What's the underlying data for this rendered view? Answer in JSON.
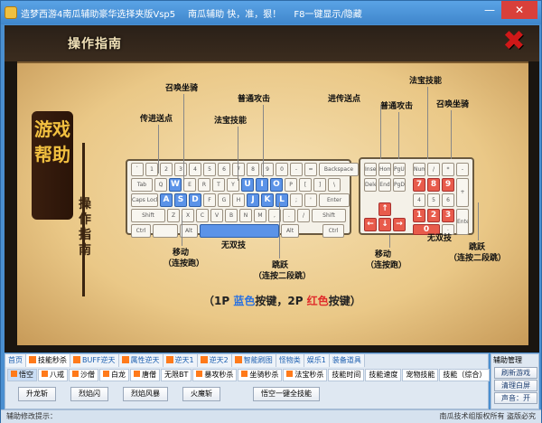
{
  "window": {
    "title_segments": [
      "造梦西游4南瓜辅助豪华选择夹版Vsp5",
      "南瓜辅助 快，准，狠！",
      "F8一键显示/隐藏"
    ],
    "minimize": "—",
    "close": "✕"
  },
  "game": {
    "guide_title": "操作指南",
    "close_symbol": "✖",
    "vertical_title": "游戏帮助",
    "vertical_subtitle": "操作指南",
    "callouts": {
      "summon": "召唤坐骑",
      "normal_attack": "普通攻击",
      "teleport": "传进送点",
      "magic_skill": "法宝技能",
      "move": "移动",
      "move_sub": "（连按跑）",
      "no_double": "无双技",
      "jump": "跳跃",
      "jump_sub": "（连按二段跳）",
      "teleport2": "进传送点",
      "normal_attack2": "普通攻击",
      "magic_skill2": "法宝技能",
      "summon2": "召唤坐骑",
      "move2": "移动",
      "move2_sub": "（连按跑）",
      "no_double2": "无双技",
      "jump2": "跳跃",
      "jump2_sub": "（连按二段跳）"
    },
    "legend": {
      "open": "（1P ",
      "blue_word": "蓝色",
      "mid": "按键，2P ",
      "red_word": "红色",
      "close": "按键）"
    },
    "keys_left": {
      "row1": [
        "`",
        "1",
        "2",
        "3",
        "4",
        "5",
        "6",
        "7",
        "8",
        "9",
        "0",
        "-",
        "=",
        "Backspace"
      ],
      "row2": [
        "Tab",
        "Q",
        "W",
        "E",
        "R",
        "T",
        "Y",
        "U",
        "I",
        "O",
        "P",
        "[",
        "]",
        "\\"
      ],
      "row3": [
        "Caps Lock",
        "A",
        "S",
        "D",
        "F",
        "G",
        "H",
        "J",
        "K",
        "L",
        ";",
        "'",
        "Enter"
      ],
      "row4": [
        "Shift",
        "Z",
        "X",
        "C",
        "V",
        "B",
        "N",
        "M",
        ",",
        ".",
        "/",
        "Shift"
      ],
      "row5": [
        "Ctrl",
        "Alt",
        "Alt",
        "Ctrl"
      ]
    },
    "keys_nav": {
      "top": [
        "Insert",
        "Home",
        "PgUp",
        "Delete",
        "End",
        "PgDn"
      ],
      "up": "↑",
      "left": "←",
      "down": "↓",
      "right": "→"
    },
    "keys_num": {
      "top": [
        "Num Lock",
        "/",
        "*",
        "-"
      ],
      "r1": [
        "7",
        "8",
        "9"
      ],
      "r2": [
        "4",
        "5",
        "6",
        "+"
      ],
      "r3": [
        "1",
        "2",
        "3"
      ],
      "r4": [
        "0",
        ".",
        "Enter"
      ]
    }
  },
  "panel": {
    "tabs": [
      {
        "label": "首页",
        "num": false
      },
      {
        "label": "技能秒杀",
        "num": true
      },
      {
        "label": "BUFF逆天",
        "num": true
      },
      {
        "label": "属性逆天",
        "num": true
      },
      {
        "label": "逆天1",
        "num": true
      },
      {
        "label": "逆天2",
        "num": true
      },
      {
        "label": "智能刷图",
        "num": true
      },
      {
        "label": "怪物类",
        "num": false
      },
      {
        "label": "娱乐1",
        "num": false
      },
      {
        "label": "装备道具",
        "num": false
      }
    ],
    "characters": [
      {
        "label": "悟空",
        "icon": true
      },
      {
        "label": "八戒",
        "icon": true
      },
      {
        "label": "沙僧",
        "icon": true
      },
      {
        "label": "白龙",
        "icon": true
      },
      {
        "label": "唐僧",
        "icon": true
      },
      {
        "label": "无限BT",
        "icon": false
      },
      {
        "label": "暴攻秒杀",
        "icon": true
      },
      {
        "label": "坐骑秒杀",
        "icon": true
      },
      {
        "label": "法宝秒杀",
        "icon": true
      },
      {
        "label": "技能时间",
        "icon": false
      },
      {
        "label": "技能速度",
        "icon": false
      },
      {
        "label": "宠物技能",
        "icon": false
      },
      {
        "label": "技能（综合）",
        "icon": false
      }
    ],
    "skills": [
      "升龙斩",
      "烈焰闪",
      "烈焰风暴",
      "火魔斩",
      "悟空一键全技能"
    ]
  },
  "side": {
    "title": "辅助管理",
    "buttons": [
      "刷新游戏",
      "清理白屏",
      "声音：开"
    ]
  },
  "status": {
    "left": "辅助修改提示：",
    "right": "南瓜技术组版权所有 盗版必究"
  }
}
